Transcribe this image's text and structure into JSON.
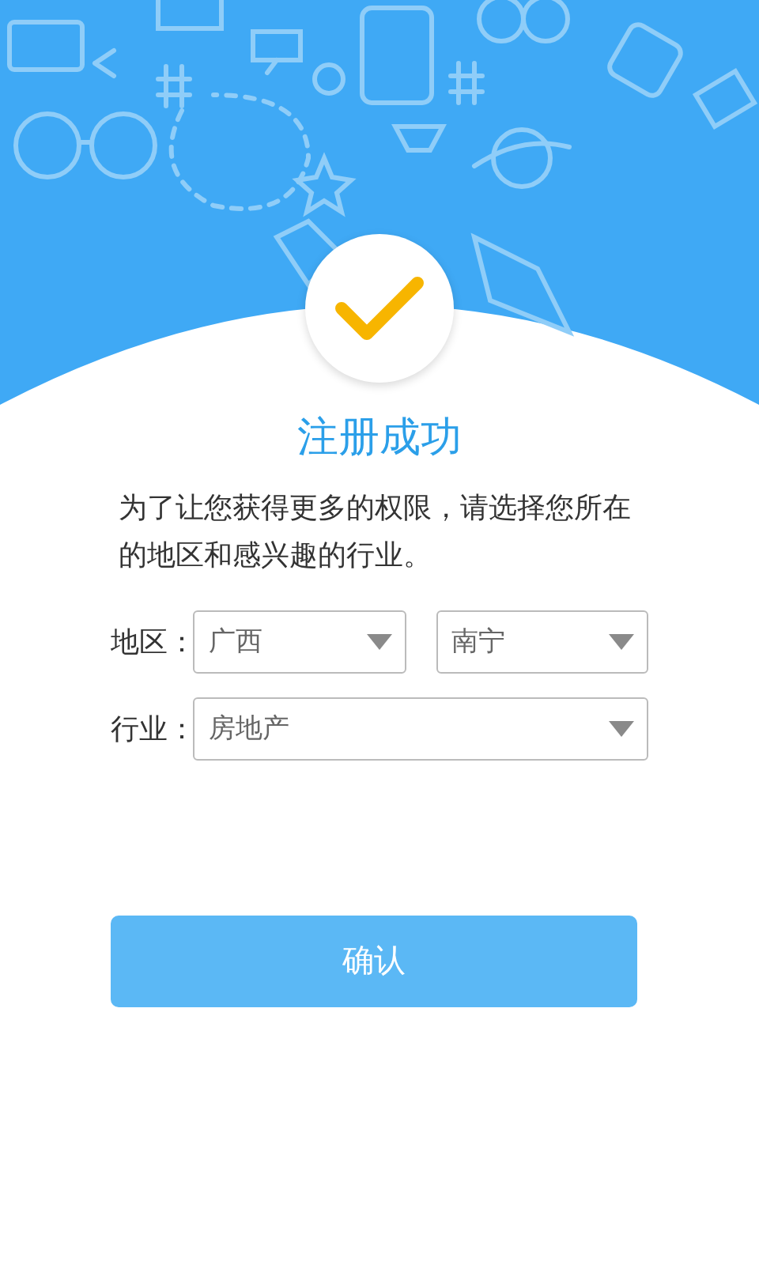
{
  "title": "注册成功",
  "message": "为了让您获得更多的权限，请选择您所在的地区和感兴趣的行业。",
  "fields": [
    {
      "label": "地区：",
      "selects": [
        {
          "value": "广西"
        },
        {
          "value": "南宁"
        }
      ]
    },
    {
      "label": "行业：",
      "selects": [
        {
          "value": "房地产"
        }
      ]
    }
  ],
  "confirm_button": "确认"
}
